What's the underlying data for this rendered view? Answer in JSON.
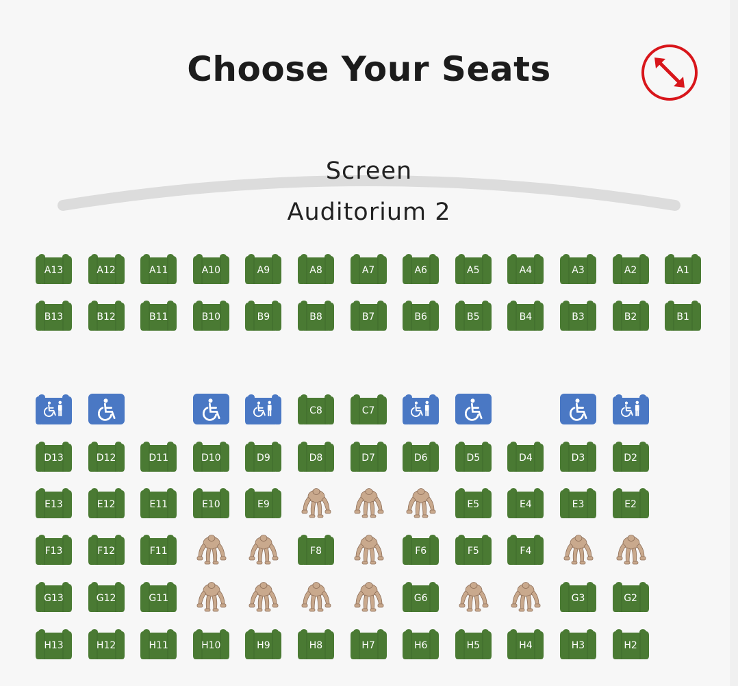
{
  "header": {
    "title": "Choose Your Seats",
    "expand_icon": "expand-arrows-icon"
  },
  "screen": {
    "label": "Screen",
    "auditorium": "Auditorium 2"
  },
  "colors": {
    "available": "#4a7a33",
    "available_dark": "#3f6a2b",
    "accessible": "#4a78c4",
    "accent_red": "#d8161b",
    "screen_arc": "#dcdcdc"
  },
  "legend_icons": {
    "wheelchair": "wheelchair-icon",
    "companion": "wheelchair-companion-icon",
    "taken": "occupied-figure-icon"
  },
  "rows": [
    {
      "row": "A",
      "seats": [
        {
          "col": 13,
          "type": "seat",
          "label": "A13"
        },
        {
          "col": 12,
          "type": "seat",
          "label": "A12"
        },
        {
          "col": 11,
          "type": "seat",
          "label": "A11"
        },
        {
          "col": 10,
          "type": "seat",
          "label": "A10"
        },
        {
          "col": 9,
          "type": "seat",
          "label": "A9"
        },
        {
          "col": 8,
          "type": "seat",
          "label": "A8"
        },
        {
          "col": 7,
          "type": "seat",
          "label": "A7"
        },
        {
          "col": 6,
          "type": "seat",
          "label": "A6"
        },
        {
          "col": 5,
          "type": "seat",
          "label": "A5"
        },
        {
          "col": 4,
          "type": "seat",
          "label": "A4"
        },
        {
          "col": 3,
          "type": "seat",
          "label": "A3"
        },
        {
          "col": 2,
          "type": "seat",
          "label": "A2"
        },
        {
          "col": 1,
          "type": "seat",
          "label": "A1"
        }
      ]
    },
    {
      "row": "B",
      "seats": [
        {
          "col": 13,
          "type": "seat",
          "label": "B13"
        },
        {
          "col": 12,
          "type": "seat",
          "label": "B12"
        },
        {
          "col": 11,
          "type": "seat",
          "label": "B11"
        },
        {
          "col": 10,
          "type": "seat",
          "label": "B10"
        },
        {
          "col": 9,
          "type": "seat",
          "label": "B9"
        },
        {
          "col": 8,
          "type": "seat",
          "label": "B8"
        },
        {
          "col": 7,
          "type": "seat",
          "label": "B7"
        },
        {
          "col": 6,
          "type": "seat",
          "label": "B6"
        },
        {
          "col": 5,
          "type": "seat",
          "label": "B5"
        },
        {
          "col": 4,
          "type": "seat",
          "label": "B4"
        },
        {
          "col": 3,
          "type": "seat",
          "label": "B3"
        },
        {
          "col": 2,
          "type": "seat",
          "label": "B2"
        },
        {
          "col": 1,
          "type": "seat",
          "label": "B1"
        }
      ]
    },
    {
      "row": "C",
      "seats": [
        {
          "col": 13,
          "type": "companion",
          "label": ""
        },
        {
          "col": 12,
          "type": "wheelchair",
          "label": ""
        },
        {
          "col": 10,
          "type": "wheelchair",
          "label": ""
        },
        {
          "col": 9,
          "type": "companion",
          "label": ""
        },
        {
          "col": 8,
          "type": "seat",
          "label": "C8"
        },
        {
          "col": 7,
          "type": "seat",
          "label": "C7"
        },
        {
          "col": 6,
          "type": "companion",
          "label": ""
        },
        {
          "col": 5,
          "type": "wheelchair",
          "label": ""
        },
        {
          "col": 3,
          "type": "wheelchair",
          "label": ""
        },
        {
          "col": 2,
          "type": "companion",
          "label": ""
        }
      ]
    },
    {
      "row": "D",
      "seats": [
        {
          "col": 13,
          "type": "seat",
          "label": "D13"
        },
        {
          "col": 12,
          "type": "seat",
          "label": "D12"
        },
        {
          "col": 11,
          "type": "seat",
          "label": "D11"
        },
        {
          "col": 10,
          "type": "seat",
          "label": "D10"
        },
        {
          "col": 9,
          "type": "seat",
          "label": "D9"
        },
        {
          "col": 8,
          "type": "seat",
          "label": "D8"
        },
        {
          "col": 7,
          "type": "seat",
          "label": "D7"
        },
        {
          "col": 6,
          "type": "seat",
          "label": "D6"
        },
        {
          "col": 5,
          "type": "seat",
          "label": "D5"
        },
        {
          "col": 4,
          "type": "seat",
          "label": "D4"
        },
        {
          "col": 3,
          "type": "seat",
          "label": "D3"
        },
        {
          "col": 2,
          "type": "seat",
          "label": "D2"
        }
      ]
    },
    {
      "row": "E",
      "seats": [
        {
          "col": 13,
          "type": "seat",
          "label": "E13"
        },
        {
          "col": 12,
          "type": "seat",
          "label": "E12"
        },
        {
          "col": 11,
          "type": "seat",
          "label": "E11"
        },
        {
          "col": 10,
          "type": "seat",
          "label": "E10"
        },
        {
          "col": 9,
          "type": "seat",
          "label": "E9"
        },
        {
          "col": 8,
          "type": "taken",
          "label": ""
        },
        {
          "col": 7,
          "type": "taken",
          "label": ""
        },
        {
          "col": 6,
          "type": "taken",
          "label": ""
        },
        {
          "col": 5,
          "type": "seat",
          "label": "E5"
        },
        {
          "col": 4,
          "type": "seat",
          "label": "E4"
        },
        {
          "col": 3,
          "type": "seat",
          "label": "E3"
        },
        {
          "col": 2,
          "type": "seat",
          "label": "E2"
        }
      ]
    },
    {
      "row": "F",
      "seats": [
        {
          "col": 13,
          "type": "seat",
          "label": "F13"
        },
        {
          "col": 12,
          "type": "seat",
          "label": "F12"
        },
        {
          "col": 11,
          "type": "seat",
          "label": "F11"
        },
        {
          "col": 10,
          "type": "taken",
          "label": ""
        },
        {
          "col": 9,
          "type": "taken",
          "label": ""
        },
        {
          "col": 8,
          "type": "seat",
          "label": "F8"
        },
        {
          "col": 7,
          "type": "taken",
          "label": ""
        },
        {
          "col": 6,
          "type": "seat",
          "label": "F6"
        },
        {
          "col": 5,
          "type": "seat",
          "label": "F5"
        },
        {
          "col": 4,
          "type": "seat",
          "label": "F4"
        },
        {
          "col": 3,
          "type": "taken",
          "label": ""
        },
        {
          "col": 2,
          "type": "taken",
          "label": ""
        }
      ]
    },
    {
      "row": "G",
      "seats": [
        {
          "col": 13,
          "type": "seat",
          "label": "G13"
        },
        {
          "col": 12,
          "type": "seat",
          "label": "G12"
        },
        {
          "col": 11,
          "type": "seat",
          "label": "G11"
        },
        {
          "col": 10,
          "type": "taken",
          "label": ""
        },
        {
          "col": 9,
          "type": "taken",
          "label": ""
        },
        {
          "col": 8,
          "type": "taken",
          "label": ""
        },
        {
          "col": 7,
          "type": "taken",
          "label": ""
        },
        {
          "col": 6,
          "type": "seat",
          "label": "G6"
        },
        {
          "col": 5,
          "type": "taken",
          "label": ""
        },
        {
          "col": 4,
          "type": "taken",
          "label": ""
        },
        {
          "col": 3,
          "type": "seat",
          "label": "G3"
        },
        {
          "col": 2,
          "type": "seat",
          "label": "G2"
        }
      ]
    },
    {
      "row": "H",
      "seats": [
        {
          "col": 13,
          "type": "seat",
          "label": "H13"
        },
        {
          "col": 12,
          "type": "seat",
          "label": "H12"
        },
        {
          "col": 11,
          "type": "seat",
          "label": "H11"
        },
        {
          "col": 10,
          "type": "seat",
          "label": "H10"
        },
        {
          "col": 9,
          "type": "seat",
          "label": "H9"
        },
        {
          "col": 8,
          "type": "seat",
          "label": "H8"
        },
        {
          "col": 7,
          "type": "seat",
          "label": "H7"
        },
        {
          "col": 6,
          "type": "seat",
          "label": "H6"
        },
        {
          "col": 5,
          "type": "seat",
          "label": "H5"
        },
        {
          "col": 4,
          "type": "seat",
          "label": "H4"
        },
        {
          "col": 3,
          "type": "seat",
          "label": "H3"
        },
        {
          "col": 2,
          "type": "seat",
          "label": "H2"
        }
      ]
    }
  ]
}
